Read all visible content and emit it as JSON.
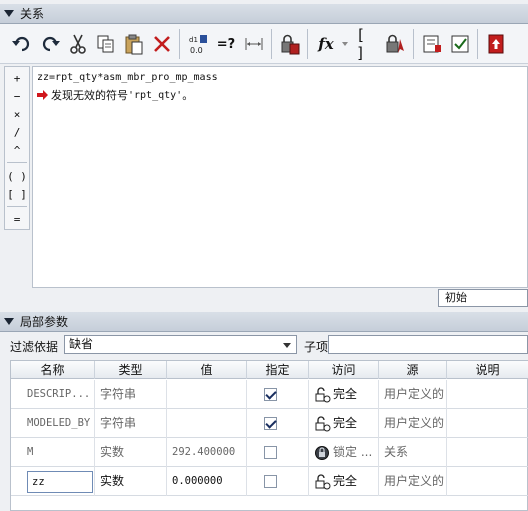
{
  "relations_panel": {
    "title": "关系"
  },
  "toolbar": {
    "icons": [
      "undo-icon",
      "redo-icon",
      "cut-icon",
      "copy-icon",
      "paste-icon",
      "delete-icon",
      "sort-icon",
      "evaluate-icon",
      "dimension-icon",
      "lock-calculator-icon",
      "function-icon",
      "parameters-icon",
      "locate-icon",
      "verify-icon",
      "check-icon",
      "close-icon"
    ],
    "evaluate_label": "=?",
    "sort_label": "0.0",
    "function_label": "fx"
  },
  "operators": [
    "+",
    "−",
    "×",
    "/",
    "^",
    "( )",
    "[ ]",
    "="
  ],
  "editor": {
    "code": "zz=rpt_qty*asm_mbr_pro_mp_mass",
    "error_prefix": "发现无效的符号 ",
    "error_symbol": "'rpt_qty'",
    "error_suffix": "。"
  },
  "initial_select": {
    "value": "初始"
  },
  "local_params_panel": {
    "title": "局部参数"
  },
  "filter": {
    "label": "过滤依据",
    "value": "缺省",
    "subitem_label": "子项"
  },
  "table": {
    "columns": [
      "名称",
      "类型",
      "值",
      "指定",
      "访问",
      "源",
      "说明"
    ],
    "rows": [
      {
        "name": "DESCRIP...",
        "type": "字符串",
        "value": "",
        "designate": true,
        "access": "完全",
        "access_icon": "unlock-icon",
        "source": "用户定义的",
        "desc": ""
      },
      {
        "name": "MODELED_BY",
        "type": "字符串",
        "value": "",
        "designate": true,
        "access": "完全",
        "access_icon": "unlock-icon",
        "source": "用户定义的",
        "desc": ""
      },
      {
        "name": "M",
        "type": "实数",
        "value": "292.400000",
        "designate": false,
        "access": "锁定 ...",
        "access_icon": "lock-icon",
        "source": "关系",
        "desc": ""
      },
      {
        "name": "zz",
        "type": "实数",
        "value": "0.000000",
        "designate": false,
        "access": "完全",
        "access_icon": "unlock-icon",
        "source": "用户定义的",
        "desc": ""
      }
    ]
  },
  "colors": {
    "header_bg": "#c6ced9",
    "error_arrow": "#d0161c",
    "check": "#1a2f60"
  }
}
